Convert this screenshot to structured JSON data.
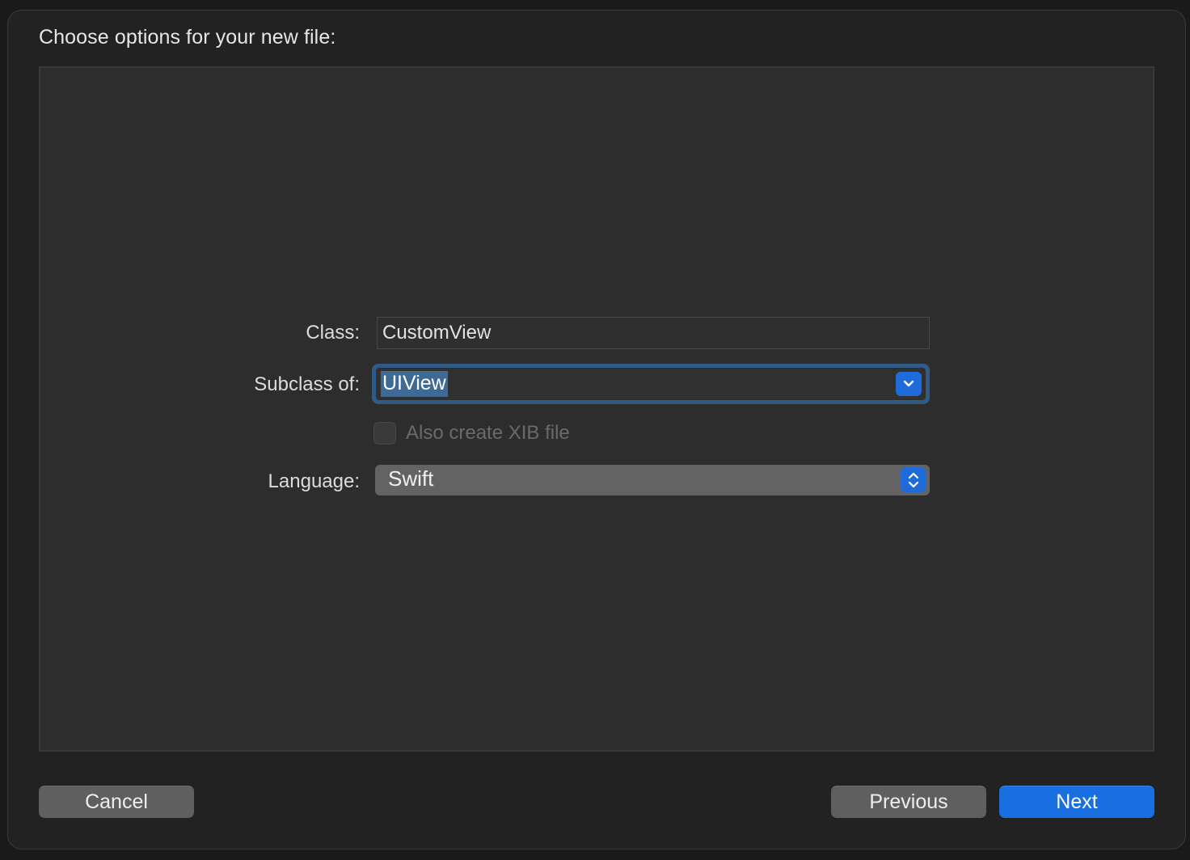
{
  "dialog": {
    "title": "Choose options for your new file:"
  },
  "form": {
    "class_label": "Class:",
    "class_value": "CustomView",
    "subclass_label": "Subclass of:",
    "subclass_value": "UIView",
    "xib_label": "Also create XIB file",
    "xib_checked": false,
    "xib_enabled": false,
    "language_label": "Language:",
    "language_value": "Swift"
  },
  "buttons": {
    "cancel": "Cancel",
    "previous": "Previous",
    "next": "Next"
  },
  "icons": {
    "combo_arrow": "chevron-down-icon",
    "popup_arrow": "chevron-up-down-icon"
  },
  "colors": {
    "accent": "#1a6fe0",
    "focus_ring": "#2f5b86",
    "selection": "#3f6a93"
  }
}
